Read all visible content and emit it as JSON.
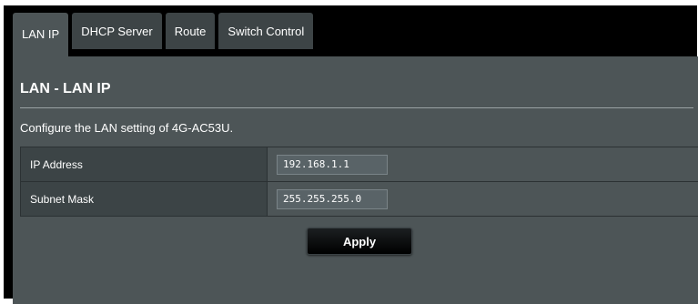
{
  "tabs": [
    {
      "label": "LAN IP",
      "active": true
    },
    {
      "label": "DHCP Server",
      "active": false
    },
    {
      "label": "Route",
      "active": false
    },
    {
      "label": "Switch Control",
      "active": false
    }
  ],
  "page": {
    "title": "LAN - LAN IP",
    "description": "Configure the LAN setting of 4G-AC53U."
  },
  "settings": {
    "rows": [
      {
        "label": "IP Address",
        "value": "192.168.1.1"
      },
      {
        "label": "Subnet Mask",
        "value": "255.255.255.0"
      }
    ]
  },
  "actions": {
    "apply_label": "Apply"
  },
  "colors": {
    "panel_bg": "#4d5557",
    "tab_bg": "#3d4446",
    "label_cell_bg": "#3c4446",
    "frame_bg": "#000000"
  }
}
